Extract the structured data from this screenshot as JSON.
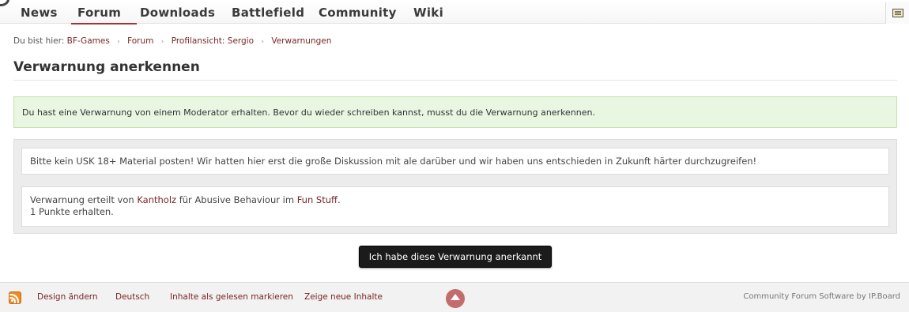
{
  "nav": {
    "items": [
      {
        "label": "News"
      },
      {
        "label": "Forum"
      },
      {
        "label": "Downloads"
      },
      {
        "label": "Battlefield"
      },
      {
        "label": "Community"
      },
      {
        "label": "Wiki"
      }
    ],
    "active": "Forum"
  },
  "breadcrumb": {
    "prefix": "Du bist hier:",
    "items": [
      {
        "label": "BF-Games"
      },
      {
        "label": "Forum"
      },
      {
        "label": "Profilansicht: Sergio"
      },
      {
        "label": "Verwarnungen"
      }
    ],
    "separator": "›"
  },
  "page": {
    "title": "Verwarnung anerkennen"
  },
  "message": {
    "text": "Du hast eine Verwarnung von einem Moderator erhalten. Bevor du wieder schreiben kannst, musst du die Verwarnung anerkennen."
  },
  "warning": {
    "reason": "Bitte kein USK 18+ Material posten! Wir hatten hier erst die große Diskussion mit ale darüber und wir haben uns entschieden in Zukunft härter durchzugreifen!",
    "issued_prefix": "Verwarnung erteilt von",
    "moderator": "Kantholz",
    "for_text": "für Abusive Behaviour im",
    "forum": "Fun Stuff",
    "period": ".",
    "points": "1 Punkte erhalten."
  },
  "actions": {
    "acknowledge_label": "Ich habe diese Verwarnung anerkannt"
  },
  "footer": {
    "links": [
      {
        "label": "Design ändern"
      },
      {
        "label": "Deutsch"
      },
      {
        "label": "Inhalte als gelesen markieren"
      },
      {
        "label": "Zeige neue Inhalte"
      }
    ],
    "copyright": "Community Forum Software by IP.Board"
  },
  "colors": {
    "accent": "#7a2525",
    "success_bg": "#e9f6e2",
    "button_bg": "#1b1b1b"
  }
}
